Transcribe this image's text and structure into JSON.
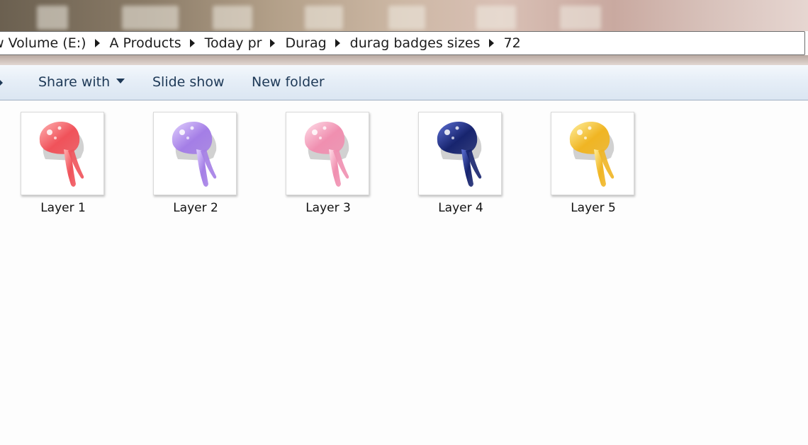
{
  "breadcrumb": {
    "items": [
      "w Volume (E:)",
      "A Products",
      "Today pr",
      "Durag",
      "durag badges sizes",
      "72"
    ]
  },
  "toolbar": {
    "share_with_label": "Share with",
    "slide_show_label": "Slide show",
    "new_folder_label": "New folder"
  },
  "files": [
    {
      "name": "Layer 1",
      "color": "#f0525a",
      "highlight": "#ffb3b3"
    },
    {
      "name": "Layer 2",
      "color": "#a47ee6",
      "highlight": "#e2d2ff"
    },
    {
      "name": "Layer 3",
      "color": "#f08fb0",
      "highlight": "#ffe0ea"
    },
    {
      "name": "Layer 4",
      "color": "#17246e",
      "highlight": "#5f72d8"
    },
    {
      "name": "Layer 5",
      "color": "#f0b523",
      "highlight": "#fff0a0"
    }
  ],
  "colors": {
    "address_text": "#1c1c1c",
    "command_text": "#1e3957",
    "command_bar_bg": "#e6eef7"
  }
}
